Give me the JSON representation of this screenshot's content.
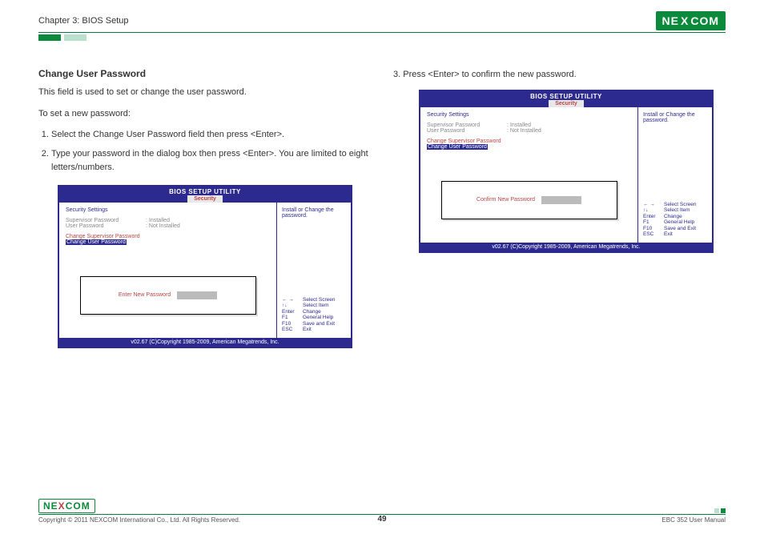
{
  "header": {
    "chapter": "Chapter 3: BIOS Setup",
    "logo_text": "NEXCOM"
  },
  "left": {
    "heading": "Change User Password",
    "p1": "This field is used to set or change the user password.",
    "p2": "To set a new password:",
    "steps": [
      "Select the Change User Password field then press <Enter>.",
      "Type your password in the dialog box then press <Enter>. You are limited to eight letters/numbers."
    ]
  },
  "right": {
    "step3_num": "3.",
    "step3": "Press <Enter> to confirm the new password."
  },
  "bios": {
    "title": "BIOS SETUP UTILITY",
    "tab": "Security",
    "section": "Security Settings",
    "rows": [
      {
        "k": "Supervisor Password",
        "v": ": Installed"
      },
      {
        "k": "User Password",
        "v": ": Not Installed"
      }
    ],
    "action1": "Change Supervisor Password",
    "action2": "Change User Password",
    "help": "Install or Change the password.",
    "keys": [
      {
        "k": "← →",
        "v": "Select Screen"
      },
      {
        "k": "↑↓",
        "v": "Select Item"
      },
      {
        "k": "Enter",
        "v": "Change"
      },
      {
        "k": "F1",
        "v": "General Help"
      },
      {
        "k": "F10",
        "v": "Save and Exit"
      },
      {
        "k": "ESC",
        "v": "Exit"
      }
    ],
    "dialog_enter": "Enter New Password",
    "dialog_confirm": "Confirm New Password",
    "copyright": "v02.67 (C)Copyright 1985-2009, American Megatrends, Inc."
  },
  "footer": {
    "logo_text": "NEXCOM",
    "copyright": "Copyright © 2011 NEXCOM International Co., Ltd. All Rights Reserved.",
    "page": "49",
    "manual": "EBC 352 User Manual"
  }
}
